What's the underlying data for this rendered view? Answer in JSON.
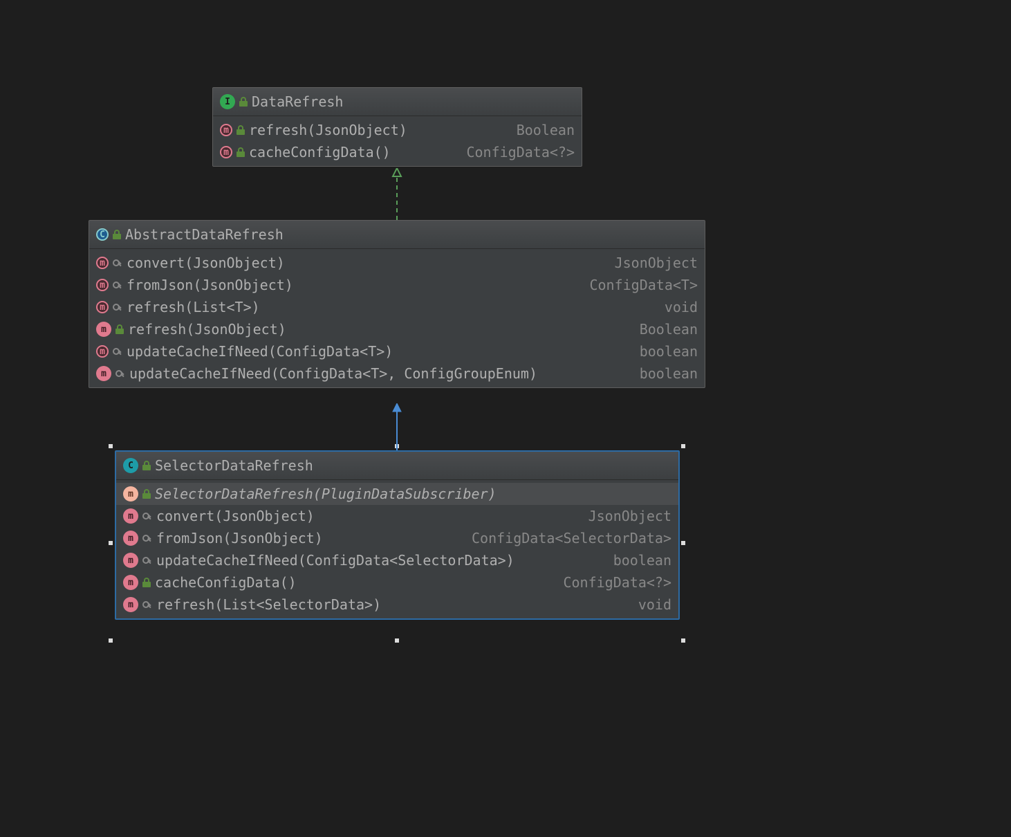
{
  "classes": {
    "interface": {
      "name": "DataRefresh",
      "kind": "I",
      "members": [
        {
          "icon": "method-abstract",
          "vis": "lock",
          "sig": "refresh(JsonObject)",
          "type": "Boolean"
        },
        {
          "icon": "method-abstract",
          "vis": "lock",
          "sig": "cacheConfigData()",
          "type": "ConfigData<?>"
        }
      ]
    },
    "abstract": {
      "name": "AbstractDataRefresh",
      "kind": "C-abstract",
      "members": [
        {
          "icon": "method-abstract",
          "vis": "key",
          "sig": "convert(JsonObject)",
          "type": "JsonObject"
        },
        {
          "icon": "method-abstract",
          "vis": "key",
          "sig": "fromJson(JsonObject)",
          "type": "ConfigData<T>"
        },
        {
          "icon": "method-abstract",
          "vis": "key",
          "sig": "refresh(List<T>)",
          "type": "void"
        },
        {
          "icon": "method",
          "vis": "lock",
          "sig": "refresh(JsonObject)",
          "type": "Boolean"
        },
        {
          "icon": "method-abstract",
          "vis": "key",
          "sig": "updateCacheIfNeed(ConfigData<T>)",
          "type": "boolean"
        },
        {
          "icon": "method",
          "vis": "key",
          "sig": "updateCacheIfNeed(ConfigData<T>, ConfigGroupEnum)",
          "type": "boolean"
        }
      ]
    },
    "concrete": {
      "name": "SelectorDataRefresh",
      "kind": "C",
      "members": [
        {
          "icon": "method-light",
          "vis": "lock",
          "sig": "SelectorDataRefresh(PluginDataSubscriber)",
          "type": "",
          "italic": true,
          "highlighted": true
        },
        {
          "icon": "method",
          "vis": "key",
          "sig": "convert(JsonObject)",
          "type": "JsonObject"
        },
        {
          "icon": "method",
          "vis": "key",
          "sig": "fromJson(JsonObject)",
          "type": "ConfigData<SelectorData>"
        },
        {
          "icon": "method",
          "vis": "key",
          "sig": "updateCacheIfNeed(ConfigData<SelectorData>)",
          "type": "boolean"
        },
        {
          "icon": "method",
          "vis": "lock",
          "sig": "cacheConfigData()",
          "type": "ConfigData<?>"
        },
        {
          "icon": "method",
          "vis": "key",
          "sig": "refresh(List<SelectorData>)",
          "type": "void"
        }
      ]
    }
  }
}
